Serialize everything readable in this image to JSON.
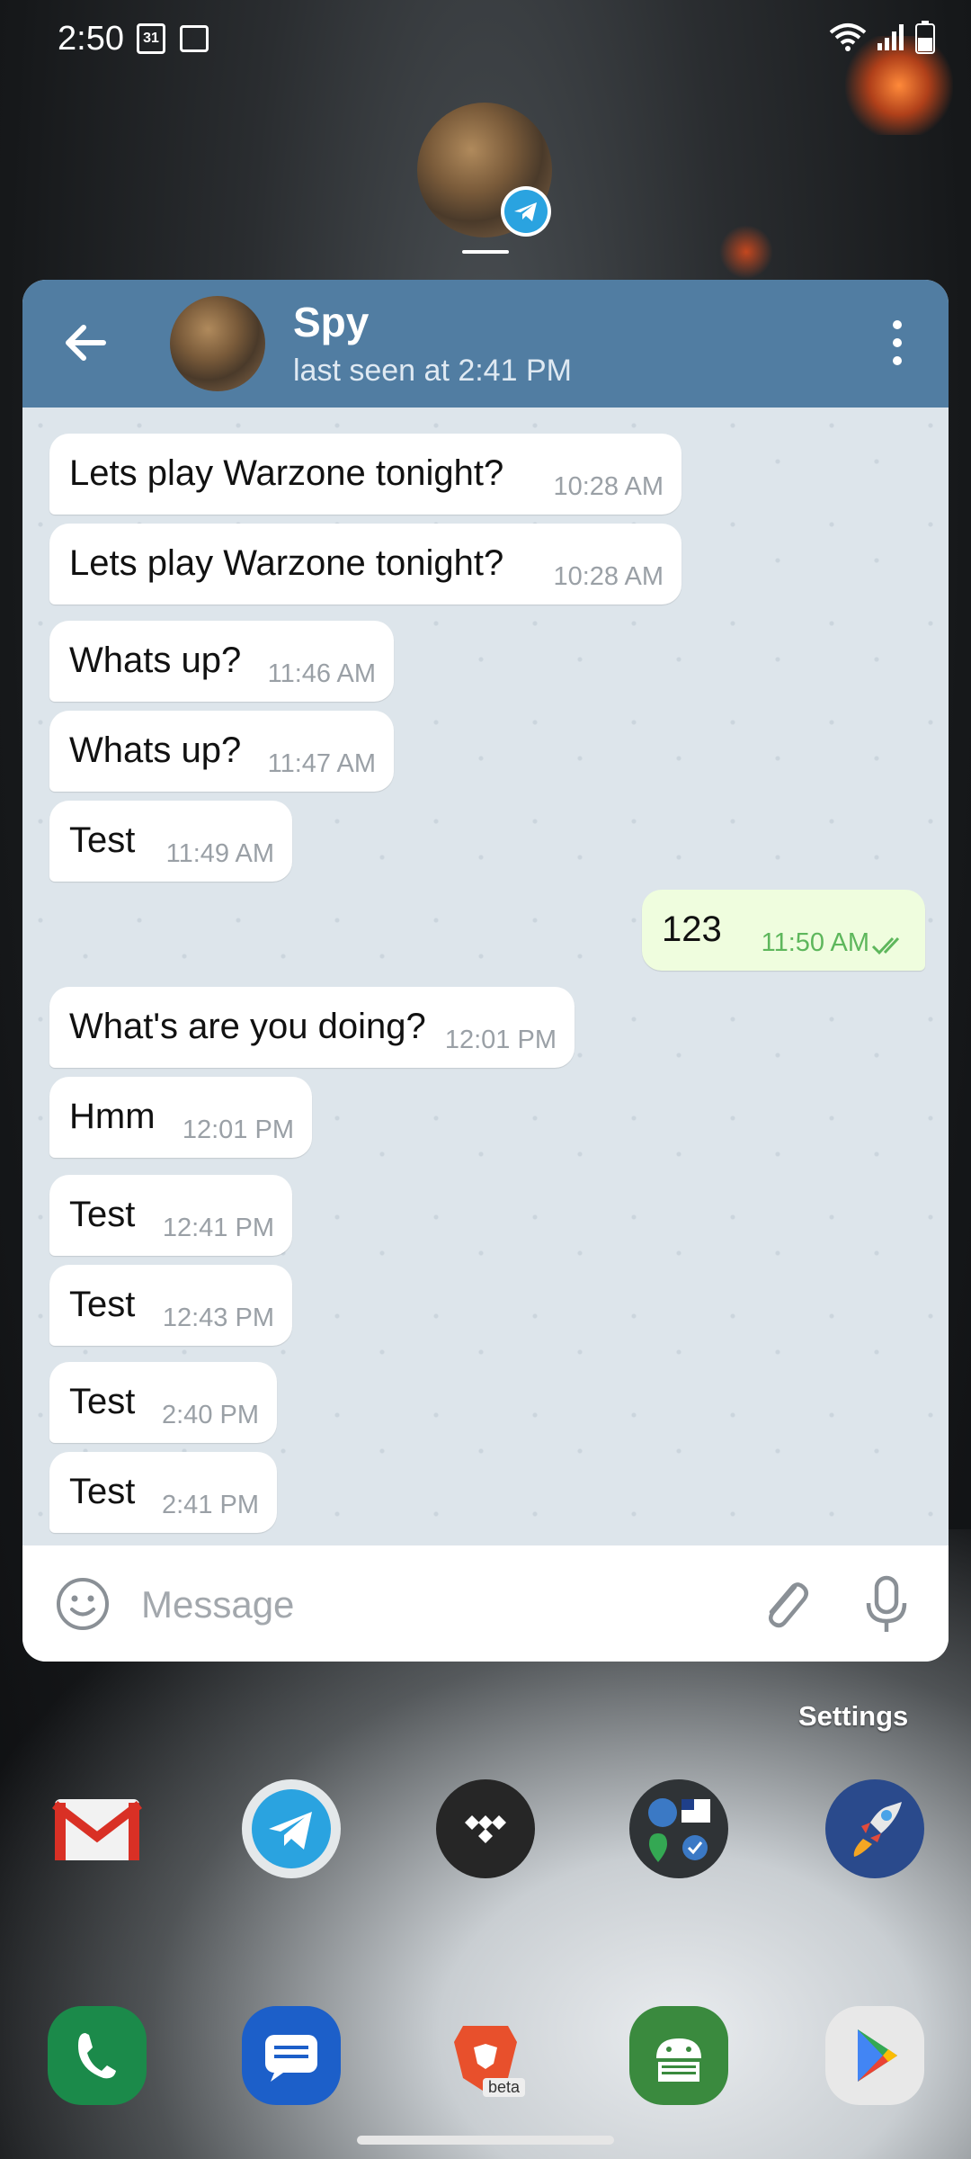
{
  "status_bar": {
    "time": "2:50",
    "calendar_day": "31"
  },
  "chat": {
    "contact_name": "Spy",
    "contact_status": "last seen at 2:41 PM",
    "messages": [
      {
        "text": "Lets play Warzone tonight?",
        "time": "10:28 AM",
        "direction": "in"
      },
      {
        "text": "Lets play Warzone tonight?",
        "time": "10:28 AM",
        "direction": "in"
      },
      {
        "text": "Whats up?",
        "time": "11:46 AM",
        "direction": "in"
      },
      {
        "text": "Whats up?",
        "time": "11:47 AM",
        "direction": "in"
      },
      {
        "text": "Test",
        "time": "11:49 AM",
        "direction": "in"
      },
      {
        "text": "123",
        "time": "11:50 AM",
        "direction": "out"
      },
      {
        "text": "What's are you doing?",
        "time": "12:01 PM",
        "direction": "in"
      },
      {
        "text": "Hmm",
        "time": "12:01 PM",
        "direction": "in"
      },
      {
        "text": "Test",
        "time": "12:41 PM",
        "direction": "in"
      },
      {
        "text": "Test",
        "time": "12:43 PM",
        "direction": "in"
      },
      {
        "text": "Test",
        "time": "2:40 PM",
        "direction": "in"
      },
      {
        "text": "Test",
        "time": "2:41 PM",
        "direction": "in"
      }
    ],
    "input_placeholder": "Message"
  },
  "home": {
    "settings_label": "Settings",
    "brave_badge": "beta",
    "row1_icons": [
      "gmail-icon",
      "telegram-icon",
      "tidal-icon",
      "folder-icon",
      "rocket-icon"
    ],
    "dock_icons": [
      "phone-icon",
      "messages-icon",
      "brave-beta-icon",
      "android-icon",
      "play-store-icon"
    ]
  },
  "colors": {
    "header": "#517da2",
    "outgoing_bubble": "#effdde",
    "incoming_bubble": "#ffffff",
    "telegram_blue": "#2aa3e0"
  }
}
